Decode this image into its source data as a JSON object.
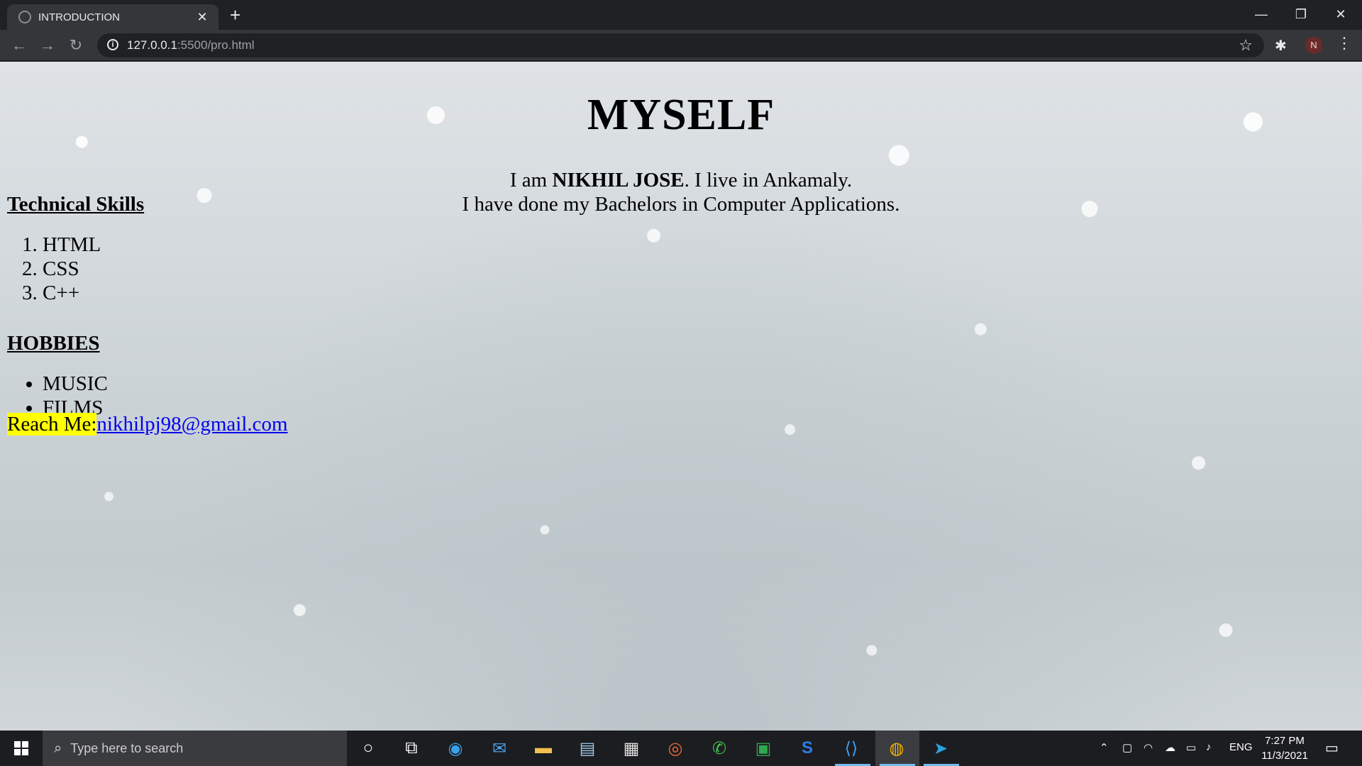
{
  "browser": {
    "tab_title": "INTRODUCTION",
    "url_host": "127.0.0.1",
    "url_path": ":5500/pro.html",
    "profile_initial": "N",
    "icons": [
      "back-icon",
      "forward-icon",
      "reload-icon",
      "info-icon",
      "star-icon",
      "extensions-icon",
      "menu-icon",
      "close-icon",
      "new-tab-icon",
      "minimize-icon",
      "restore-icon"
    ]
  },
  "page": {
    "heading": "MYSELF",
    "intro_prefix": "I am ",
    "intro_name": "NIKHIL JOSE",
    "intro_suffix": ". I live in Ankamaly.",
    "intro_line2": "I have done my Bachelors in Computer Applications.",
    "skills_heading": "Technical Skills",
    "skills": [
      "HTML",
      "CSS",
      "C++"
    ],
    "hobbies_heading": "HOBBIES",
    "hobbies": [
      "MUSIC",
      "FILMS"
    ],
    "reach_label": "Reach Me:",
    "email": "nikhilpj98@gmail.com",
    "colors": {
      "highlight": "#ffff00",
      "link": "#0000ee"
    }
  },
  "taskbar": {
    "search_placeholder": "Type here to search",
    "language": "ENG",
    "time": "7:27 PM",
    "date": "11/3/2021"
  }
}
